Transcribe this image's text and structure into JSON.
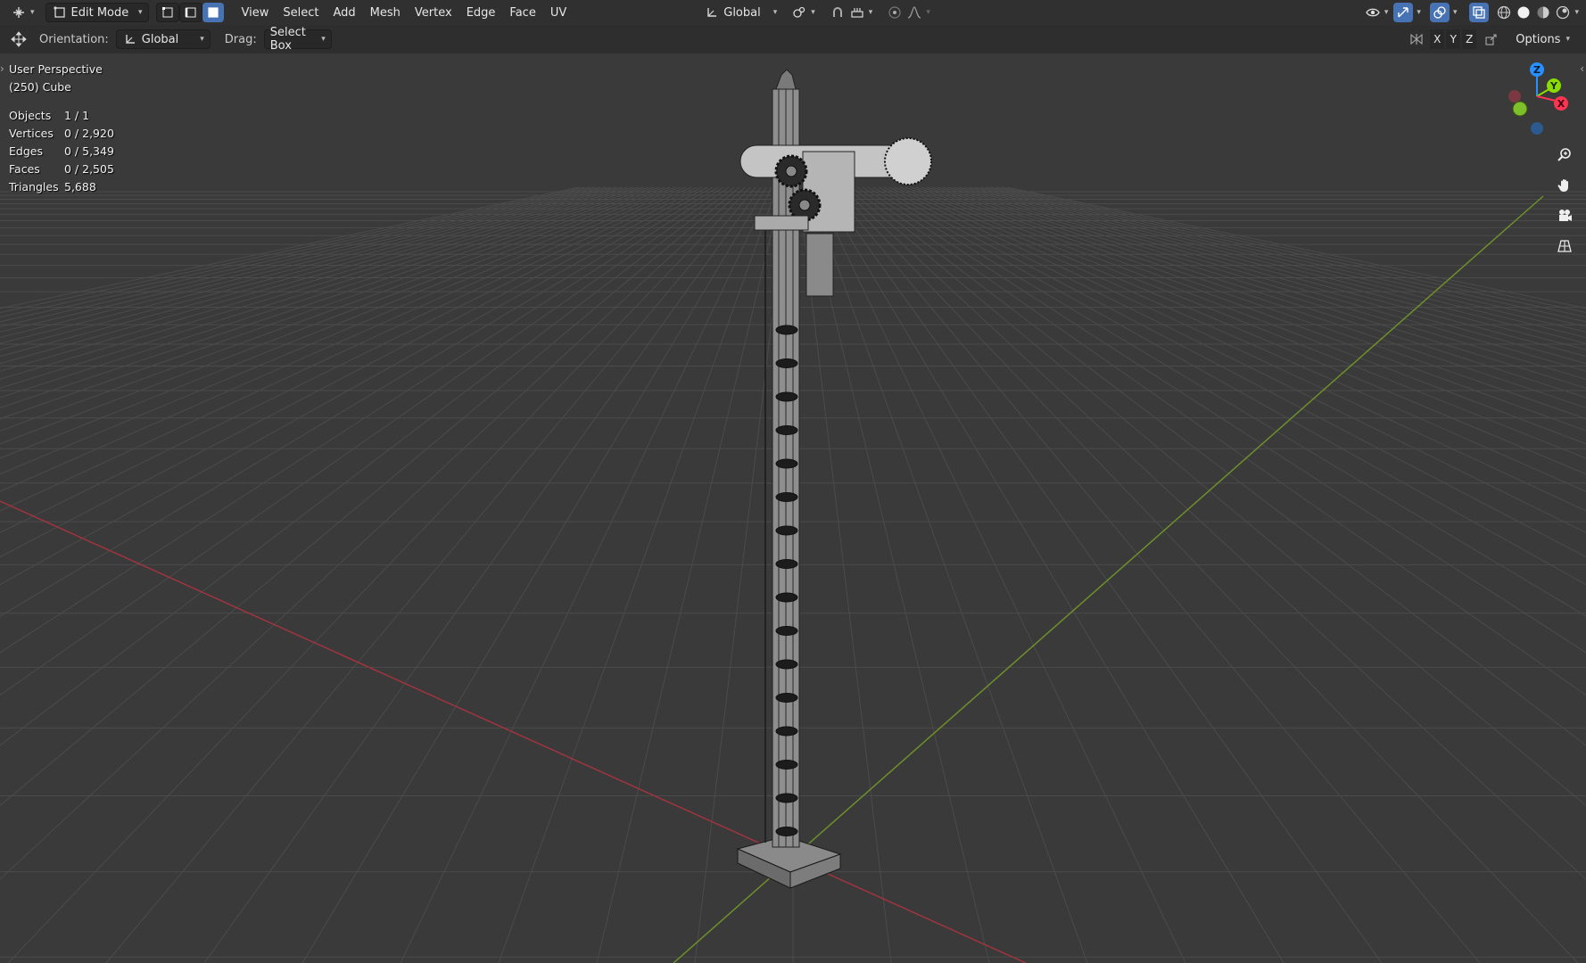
{
  "header": {
    "editor_type_icon": "editor-type-icon",
    "mode": "Edit Mode",
    "select_modes": [
      "vertex-select-icon",
      "edge-select-icon",
      "face-select-icon"
    ],
    "menus": [
      "View",
      "Select",
      "Add",
      "Mesh",
      "Vertex",
      "Edge",
      "Face",
      "UV"
    ],
    "transform_orientation": "Global",
    "pivot_icon": "pivot-point-icon",
    "snap_icon": "snap-magnet-icon",
    "proportional_icon": "proportional-edit-icon",
    "falloff_icon": "falloff-curve-icon",
    "visibility_icon": "eye-visibility-icon",
    "gizmo_icon": "gizmo-toggle-icon",
    "overlay_icon": "overlay-toggle-icon",
    "xray_icon": "xray-toggle-icon",
    "shading_icons": [
      "wireframe-shading-icon",
      "solid-shading-icon",
      "material-shading-icon",
      "rendered-shading-icon"
    ]
  },
  "toolbar": {
    "tool_icon": "move-tool-icon",
    "orientation_label": "Orientation:",
    "orientation_value": "Global",
    "drag_label": "Drag:",
    "drag_value": "Select Box",
    "mirror_axes": [
      "X",
      "Y",
      "Z"
    ],
    "options_label": "Options"
  },
  "viewport": {
    "view_name": "User Perspective",
    "object_info": "(250) Cube",
    "stats": [
      {
        "label": "Objects",
        "value": "1 / 1"
      },
      {
        "label": "Vertices",
        "value": "0 / 2,920"
      },
      {
        "label": "Edges",
        "value": "0 / 5,349"
      },
      {
        "label": "Faces",
        "value": "0 / 2,505"
      },
      {
        "label": "Triangles",
        "value": "5,688"
      }
    ],
    "gizmo_axes": {
      "z": "Z",
      "y": "Y",
      "x": "X"
    },
    "axis_colors": {
      "x": "#ff3352",
      "y": "#8bdc00",
      "z": "#2890ff"
    },
    "nav_icons": [
      "zoom-icon",
      "pan-hand-icon",
      "camera-icon",
      "ortho-grid-icon"
    ]
  }
}
